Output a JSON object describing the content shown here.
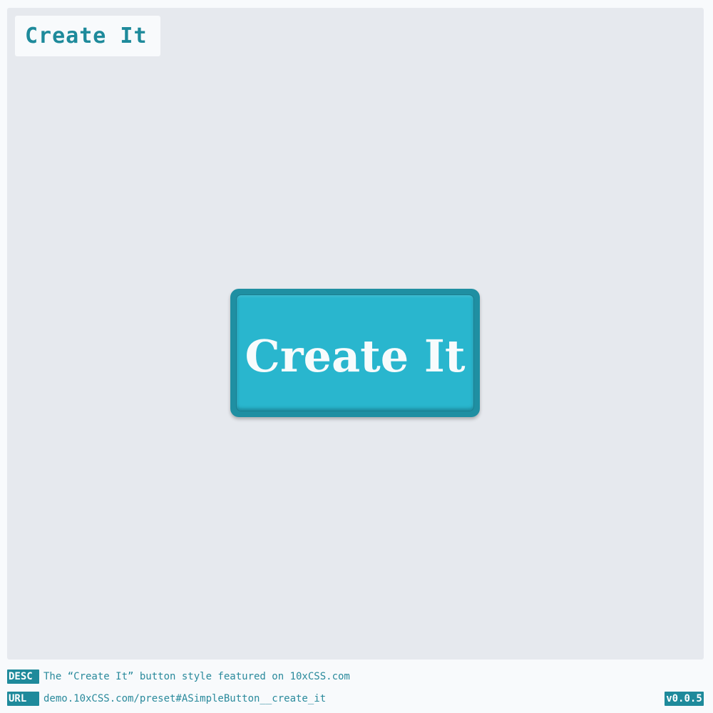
{
  "header": {
    "title": "Create It"
  },
  "demo": {
    "button_label": "Create It"
  },
  "footer": {
    "desc_tag": "DESC",
    "desc_text": "The “Create It” button style featured on 10xCSS.com",
    "url_tag": "URL",
    "url_text": "demo.10xCSS.com/preset#ASimpleButton__create_it",
    "version": "v0.0.5"
  },
  "colors": {
    "accent": "#1e8a9b",
    "button_face": "#29b6ce",
    "button_frame": "#1f8fa2",
    "stage_background": "#e6e9ee",
    "page_background": "#f8fafc"
  }
}
